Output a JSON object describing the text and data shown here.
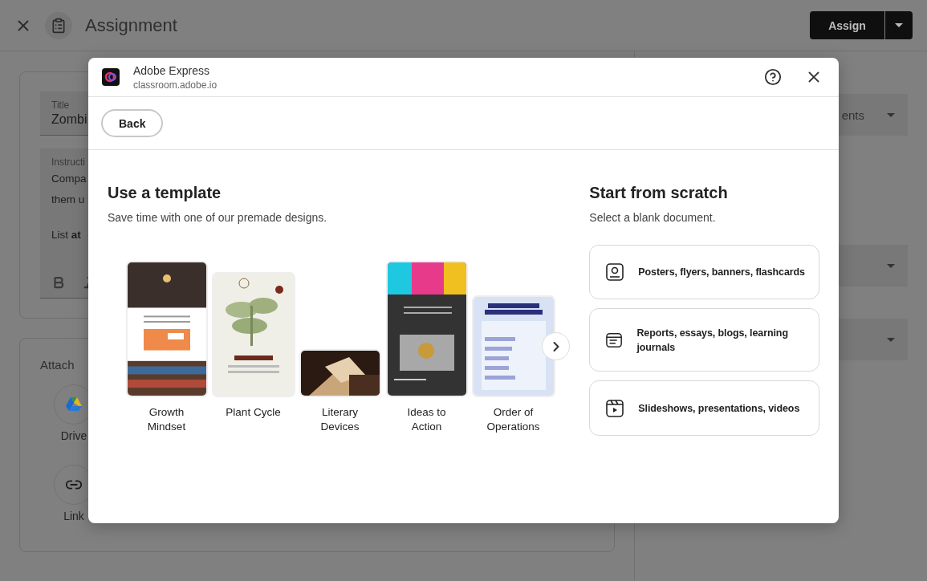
{
  "app_bar": {
    "title": "Assignment",
    "assign_button": "Assign"
  },
  "form": {
    "title_field": {
      "label": "Title",
      "value": "Zombi"
    },
    "instructions_field": {
      "label": "Instructi",
      "lines": [
        "Compa",
        "them u",
        "List **at**"
      ]
    }
  },
  "attach": {
    "label": "Attach",
    "items": [
      {
        "kind": "drive",
        "label": "Drive"
      },
      {
        "kind": "link",
        "label": "Link"
      }
    ]
  },
  "side_panel": {
    "dropdowns": [
      {
        "kind": "filled",
        "value": "ents"
      },
      {
        "kind": "blank"
      },
      {
        "kind": "blank"
      }
    ]
  },
  "dialog": {
    "app_name": "Adobe Express",
    "url": "classroom.adobe.io",
    "back_button": "Back",
    "templates": {
      "title": "Use a template",
      "subtitle": "Save time with one of our premade designs.",
      "items": [
        {
          "name": "Growth Mindset"
        },
        {
          "name": "Plant Cycle"
        },
        {
          "name": "Literary Devices"
        },
        {
          "name": "Ideas to Action"
        },
        {
          "name": "Order of Operations"
        }
      ]
    },
    "scratch": {
      "title": "Start from scratch",
      "subtitle": "Select a blank document.",
      "options": [
        {
          "kind": "poster",
          "label": "Posters, flyers, banners, flashcards"
        },
        {
          "kind": "document",
          "label": "Reports, essays, blogs, learning journals"
        },
        {
          "kind": "video",
          "label": "Slideshows, presentations, videos"
        }
      ]
    }
  }
}
